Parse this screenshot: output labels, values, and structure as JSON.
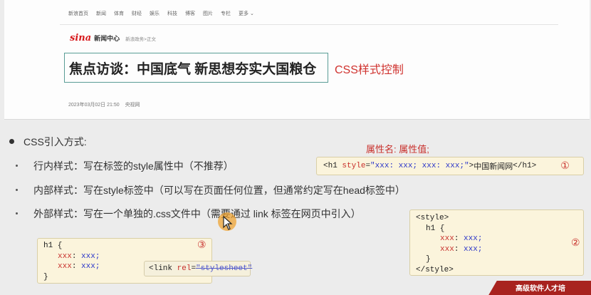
{
  "panel": {
    "nav_items": [
      "新浪首页",
      "新闻",
      "体育",
      "财经",
      "娱乐",
      "科技",
      "博客",
      "图片",
      "专栏",
      "更多"
    ],
    "nav_more_icon": "chevron-down-icon",
    "logo_brand": "sina",
    "logo_center": "新闻中心",
    "breadcrumb": "新浪政务>正文",
    "headline": "焦点访谈：中国底气 新思想夯实大国粮仓",
    "css_note": "CSS样式控制",
    "date": "2023年03月02日 21:50",
    "source": "央视网"
  },
  "slide": {
    "main_bullet": "CSS引入方式:",
    "items": [
      "行内样式：写在标签的style属性中（不推荐）",
      "内部样式：写在style标签中（可以写在页面任何位置，但通常约定写在head标签中）",
      "外部样式：写在一个单独的.css文件中（需要通过 link 标签在网页中引入）"
    ],
    "attr_label": "属性名: 属性值;",
    "inline_code": {
      "open_tag": "<h1",
      "attr": "style",
      "eq": "=",
      "value": "\"xxx: xxx; xxx: xxx;\"",
      "close": ">",
      "text": "中国新闻网",
      "end_tag": "</h1>",
      "marker": "①"
    },
    "style_code": {
      "line1": "<style>",
      "line2": "h1 {",
      "prop1": "xxx",
      "val1": "xxx;",
      "prop2": "xxx",
      "val2": "xxx;",
      "line5": "}",
      "line6": "</style>",
      "marker": "②"
    },
    "h1_code": {
      "line1": "h1 {",
      "prop1": "xxx",
      "val1": "xxx;",
      "prop2": "xxx",
      "val2": "xxx;",
      "line4": "}",
      "marker": "③"
    },
    "link_code": {
      "open": "<link",
      "attr": "rel",
      "eq": "=",
      "value": "\"stylesheet\""
    },
    "corner_text": "高级软件人才培"
  }
}
